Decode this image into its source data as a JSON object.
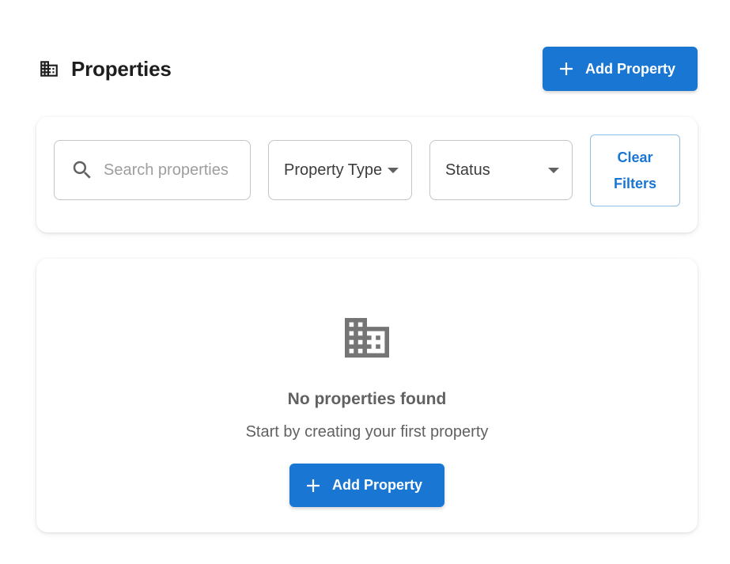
{
  "header": {
    "title": "Properties",
    "title_icon": "building-icon",
    "add_button_label": "Add Property",
    "add_button_icon": "plus-icon"
  },
  "filters": {
    "search": {
      "placeholder": "Search properties",
      "value": "",
      "icon": "search-icon"
    },
    "property_type": {
      "label": "Property Type",
      "icon": "chevron-down-icon"
    },
    "status": {
      "label": "Status",
      "icon": "chevron-down-icon"
    },
    "clear_button_label": "Clear Filters"
  },
  "empty_state": {
    "icon": "building-icon",
    "title": "No properties found",
    "subtitle": "Start by creating your first property",
    "button_label": "Add Property",
    "button_icon": "plus-icon"
  },
  "colors": {
    "primary": "#1976d2",
    "outline_border": "#90bde8",
    "muted_text": "#616161",
    "icon_gray": "#757575"
  }
}
